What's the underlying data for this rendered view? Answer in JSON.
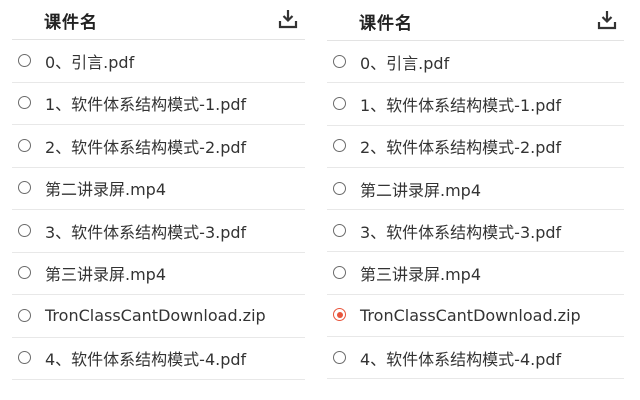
{
  "panels": [
    {
      "header": {
        "title": "课件名",
        "download_icon": "download-icon"
      },
      "items": [
        {
          "label": "0、引言.pdf",
          "selected": false
        },
        {
          "label": "1、软件体系结构模式-1.pdf",
          "selected": false
        },
        {
          "label": "2、软件体系结构模式-2.pdf",
          "selected": false
        },
        {
          "label": "第二讲录屏.mp4",
          "selected": false
        },
        {
          "label": "3、软件体系结构模式-3.pdf",
          "selected": false
        },
        {
          "label": "第三讲录屏.mp4",
          "selected": false
        },
        {
          "label": "TronClassCantDownload.zip",
          "selected": false
        },
        {
          "label": "4、软件体系结构模式-4.pdf",
          "selected": false
        }
      ]
    },
    {
      "header": {
        "title": "课件名",
        "download_icon": "download-icon"
      },
      "items": [
        {
          "label": "0、引言.pdf",
          "selected": false
        },
        {
          "label": "1、软件体系结构模式-1.pdf",
          "selected": false
        },
        {
          "label": "2、软件体系结构模式-2.pdf",
          "selected": false
        },
        {
          "label": "第二讲录屏.mp4",
          "selected": false
        },
        {
          "label": "3、软件体系结构模式-3.pdf",
          "selected": false
        },
        {
          "label": "第三讲录屏.mp4",
          "selected": false
        },
        {
          "label": "TronClassCantDownload.zip",
          "selected": true
        },
        {
          "label": "4、软件体系结构模式-4.pdf",
          "selected": false
        }
      ]
    }
  ],
  "colors": {
    "accent": "#e8553c",
    "text": "#333333",
    "border": "#e8e8e8"
  }
}
